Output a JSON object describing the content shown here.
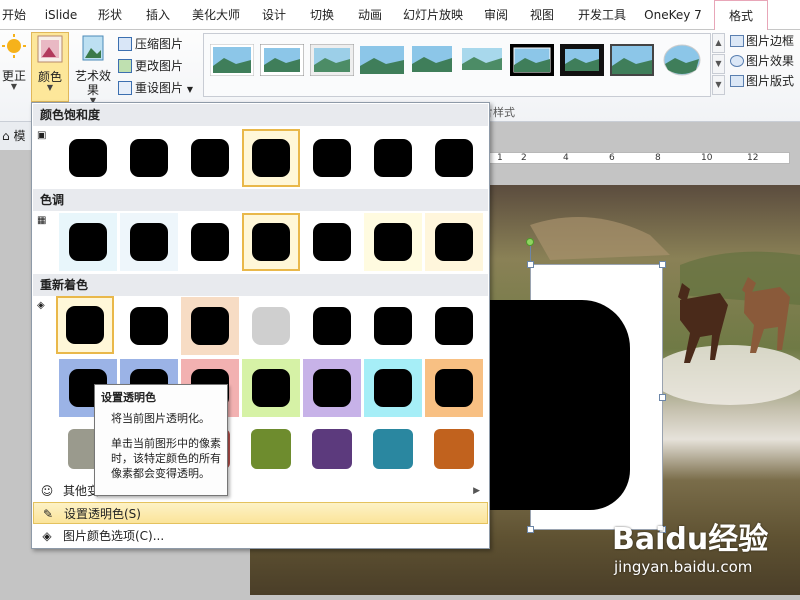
{
  "tabs": [
    {
      "label": "开始"
    },
    {
      "label": "iSlide"
    },
    {
      "label": "形状"
    },
    {
      "label": "插入"
    },
    {
      "label": "美化大师"
    },
    {
      "label": "设计"
    },
    {
      "label": "切换"
    },
    {
      "label": "动画"
    },
    {
      "label": "幻灯片放映"
    },
    {
      "label": "审阅"
    },
    {
      "label": "视图"
    },
    {
      "label": "开发工具"
    },
    {
      "label": "OneKey 7"
    },
    {
      "label": "格式"
    }
  ],
  "ribbon": {
    "correct_label": "更正",
    "color_label": "颜色",
    "art_label": "艺术效果",
    "compress_label": "压缩图片",
    "change_label": "更改图片",
    "reset_label": "重设图片",
    "border_label": "图片边框",
    "effect_label": "图片效果",
    "layout_label": "图片版式",
    "group_label": "片样式"
  },
  "left_pane": {
    "label": "模"
  },
  "ruler": {
    "labels": [
      "1",
      "2",
      "4",
      "6",
      "8",
      "10",
      "12"
    ]
  },
  "dropdown": {
    "saturation_header": "颜色饱和度",
    "tone_header": "色调",
    "recolor_header": "重新着色",
    "more_variants_label": "其他变",
    "set_transparent_label": "设置透明色(S)",
    "color_options_label": "图片颜色选项(C)..."
  },
  "tooltip": {
    "title": "设置透明色",
    "line1": "将当前图片透明化。",
    "body": "单击当前图形中的像素时，该特定颜色的所有像素都会变得透明。"
  },
  "watermark": {
    "logo": "Baidu经验",
    "url": "jingyan.baidu.com"
  },
  "colors": {
    "accent_tab": "#e8a6b8",
    "selected_swatch": "#e9b84a",
    "highlight_menu": "#fbe49a",
    "recolor_row2": [
      "#9bb3e6",
      "#f2b1b1",
      "#d6f2a6",
      "#c7b2e8",
      "#a6eef7",
      "#f8c083"
    ],
    "recolor_row3": [
      "#9a9a8d",
      "#5d7ea7",
      "#b8524e",
      "#6e8c2e",
      "#5c3a7d",
      "#2a87a0",
      "#c1621e"
    ],
    "tone_backgrounds": [
      "#e8f6fb",
      "#eef6fb",
      "#ffffff",
      "#fffbe6",
      "#ffffff",
      "#fffbe0",
      "#fff6dc"
    ],
    "recolor_row1_bg": [
      "#ffffff",
      "#ffffff",
      "#f7dcc4",
      "#ffffff",
      "#ffffff",
      "#ffffff",
      "#ffffff"
    ]
  }
}
